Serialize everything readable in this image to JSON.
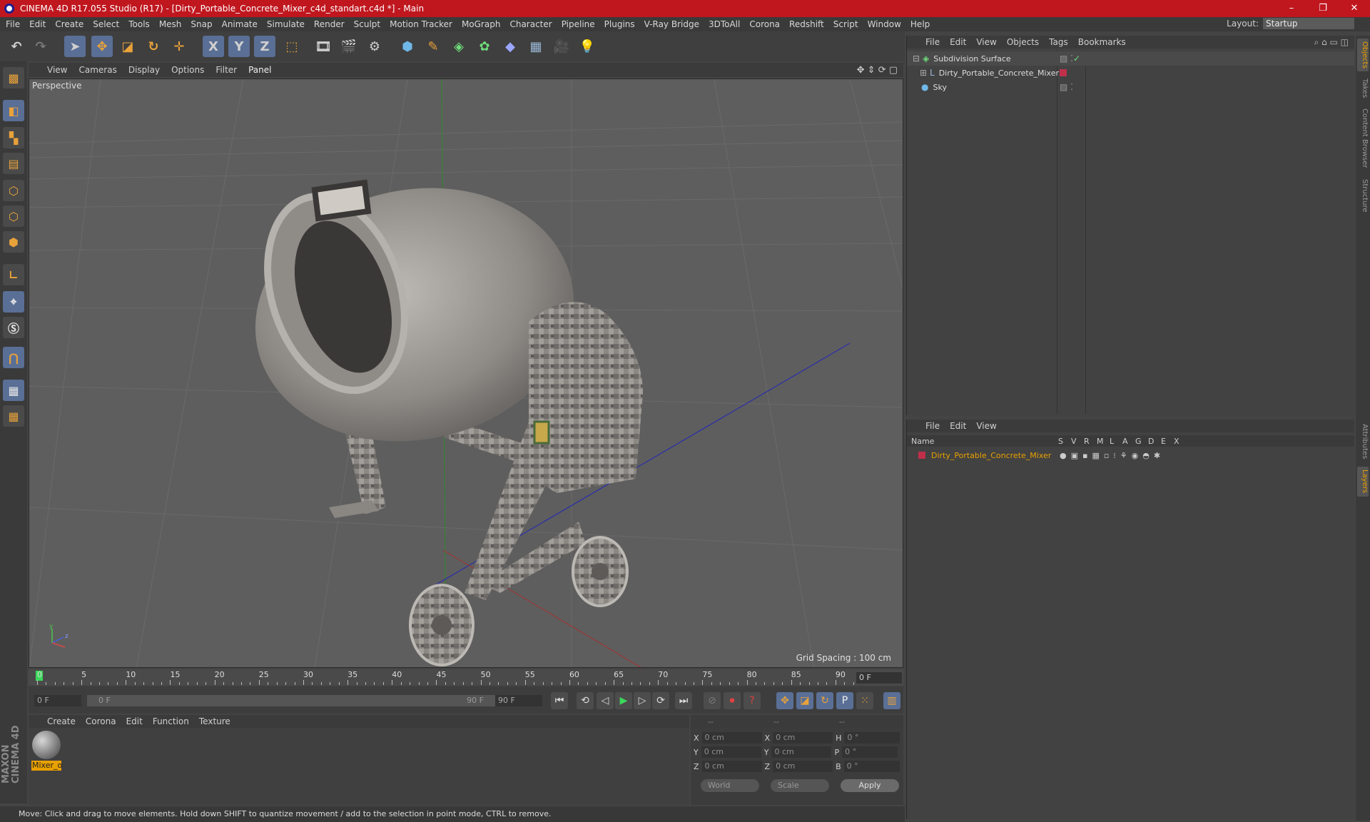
{
  "window": {
    "title": "CINEMA 4D R17.055 Studio (R17) - [Dirty_Portable_Concrete_Mixer_c4d_standart.c4d *] - Main",
    "controls": [
      "–",
      "❐",
      "✕"
    ]
  },
  "menubar": {
    "items": [
      "File",
      "Edit",
      "Create",
      "Select",
      "Tools",
      "Mesh",
      "Snap",
      "Animate",
      "Simulate",
      "Render",
      "Sculpt",
      "Motion Tracker",
      "MoGraph",
      "Character",
      "Pipeline",
      "Plugins",
      "V-Ray Bridge",
      "3DToAll",
      "Corona",
      "Redshift",
      "Script",
      "Window",
      "Help"
    ],
    "layout_label": "Layout:",
    "layout_value": "Startup"
  },
  "toolbar": {
    "axis_labels": [
      "X",
      "Y",
      "Z"
    ]
  },
  "viewport": {
    "menu": [
      "View",
      "Cameras",
      "Display",
      "Options",
      "Filter",
      "Panel"
    ],
    "camera_label": "Perspective",
    "grid_spacing": "Grid Spacing : 100 cm",
    "axis_y": "y",
    "axis_z": "z"
  },
  "timeline": {
    "ticks": [
      "0",
      "5",
      "10",
      "15",
      "20",
      "25",
      "30",
      "35",
      "40",
      "45",
      "50",
      "55",
      "60",
      "65",
      "70",
      "75",
      "80",
      "85",
      "90"
    ],
    "current_frame": "0 F",
    "start_frame": "0 F",
    "range_start": "0 F",
    "range_end": "90 F",
    "end_frame": "90 F"
  },
  "material_manager": {
    "menu": [
      "Create",
      "Corona",
      "Edit",
      "Function",
      "Texture"
    ],
    "materials": [
      {
        "name": "Mixer_o"
      }
    ]
  },
  "coordinates": {
    "header": [
      "--",
      "--",
      "--"
    ],
    "rows": [
      {
        "a": "X",
        "av": "0 cm",
        "b": "X",
        "bv": "0 cm",
        "c": "H",
        "cv": "0 °"
      },
      {
        "a": "Y",
        "av": "0 cm",
        "b": "Y",
        "bv": "0 cm",
        "c": "P",
        "cv": "0 °"
      },
      {
        "a": "Z",
        "av": "0 cm",
        "b": "Z",
        "bv": "0 cm",
        "c": "B",
        "cv": "0 °"
      }
    ],
    "world": "World",
    "scale": "Scale",
    "apply": "Apply"
  },
  "status": {
    "text": "Move: Click and drag to move elements. Hold down SHIFT to quantize movement / add to the selection in point mode, CTRL to remove."
  },
  "object_manager": {
    "menu": [
      "File",
      "Edit",
      "View",
      "Objects",
      "Tags",
      "Bookmarks"
    ],
    "objects": [
      {
        "name": "Subdivision Surface"
      },
      {
        "name": "Dirty_Portable_Concrete_Mixer"
      },
      {
        "name": "Sky"
      }
    ]
  },
  "layer_manager": {
    "menu": [
      "File",
      "Edit",
      "View"
    ],
    "columns": [
      "Name",
      "S",
      "V",
      "R",
      "M",
      "L",
      "A",
      "G",
      "D",
      "E",
      "X"
    ],
    "layers": [
      {
        "name": "Dirty_Portable_Concrete_Mixer"
      }
    ]
  },
  "right_tabs": [
    "Objects",
    "Takes",
    "Content Browser",
    "Structure",
    "Attributes",
    "Layers"
  ],
  "colors": {
    "accent": "#e8a000",
    "titlebar": "#c0171f",
    "selected_tool": "#5a6f95",
    "layer_color": "#c0304a"
  }
}
